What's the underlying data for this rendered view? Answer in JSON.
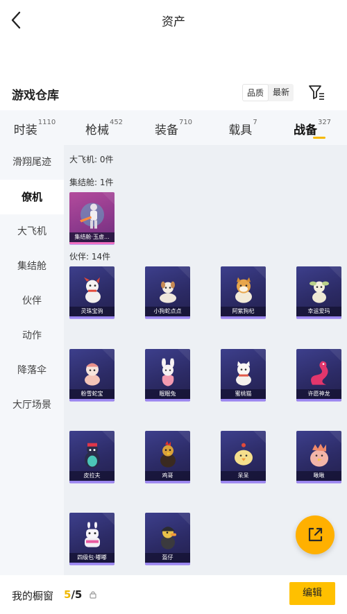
{
  "header": {
    "title": "资产"
  },
  "warehouse": {
    "title": "游戏仓库",
    "sort_options": [
      "品质",
      "最新"
    ],
    "active_sort": 0
  },
  "tabs": [
    {
      "label": "时装",
      "count": "1110"
    },
    {
      "label": "枪械",
      "count": "452"
    },
    {
      "label": "装备",
      "count": "710"
    },
    {
      "label": "载具",
      "count": "7"
    },
    {
      "label": "战备",
      "count": "327",
      "active": true
    }
  ],
  "sidebar": {
    "items": [
      "滑翔尾迹",
      "僚机",
      "大飞机",
      "集结舱",
      "伙伴",
      "动作",
      "降落伞",
      "大厅场景"
    ],
    "active_index": 1
  },
  "sections": {
    "big_plane": {
      "title": "大飞机: 0件"
    },
    "rally": {
      "title": "集结舱: 1件",
      "items": [
        "集结舱·玉虚..."
      ]
    },
    "partner": {
      "title": "伙伴: 14件",
      "items": [
        "灵珠宝驹",
        "小狗蛇点点",
        "阿紫狗杞",
        "幸运爱玛",
        "粉雪蛇宝",
        "眠眠兔",
        "蜜桃猫",
        "许愿神龙",
        "皮拉夫",
        "鸡哥",
        "呆呆",
        "啾啾",
        "四级包·嘟嘟",
        "盔仔"
      ]
    }
  },
  "bottom": {
    "label": "我的橱窗",
    "current": "5",
    "sep": "/",
    "total": "5",
    "edit_label": "编辑"
  },
  "colors": {
    "accent": "#ffc000",
    "card_bg": "#2c2b66",
    "card_border": "#9b86f0"
  },
  "icons": {
    "back": "chevron-left-icon",
    "filter": "filter-icon",
    "share": "share-external-icon",
    "lock": "lock-icon"
  }
}
